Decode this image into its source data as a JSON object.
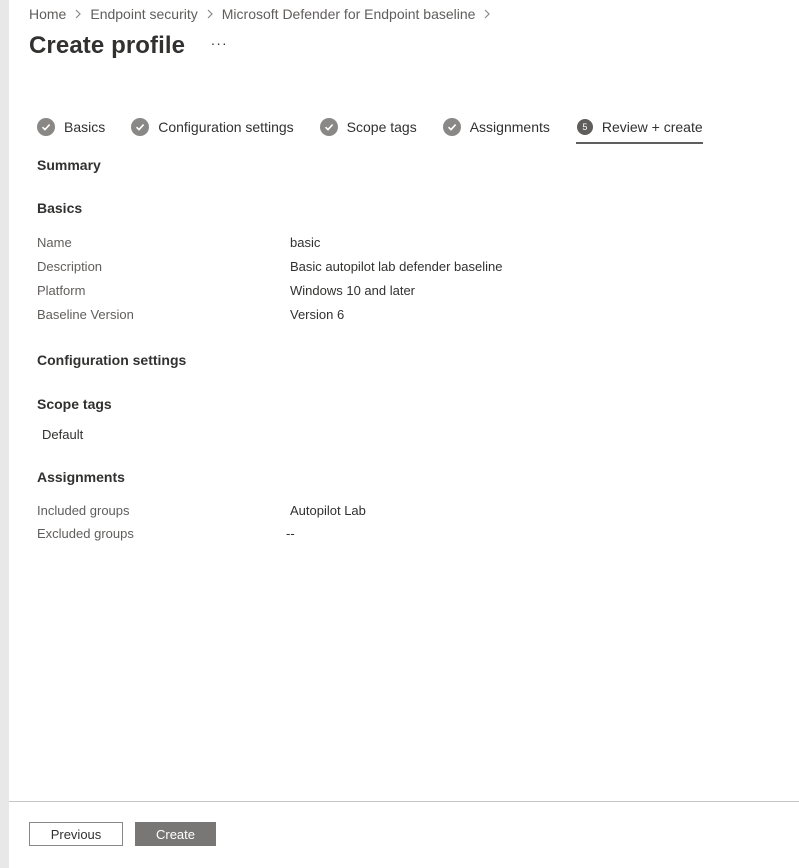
{
  "breadcrumb": {
    "items": [
      "Home",
      "Endpoint security",
      "Microsoft Defender for Endpoint baseline"
    ]
  },
  "page": {
    "title": "Create profile",
    "more_label": "···"
  },
  "steps": [
    {
      "label": "Basics",
      "state": "complete",
      "icon": "checkmark-icon"
    },
    {
      "label": "Configuration settings",
      "state": "complete",
      "icon": "checkmark-icon"
    },
    {
      "label": "Scope tags",
      "state": "complete",
      "icon": "checkmark-icon"
    },
    {
      "label": "Assignments",
      "state": "complete",
      "icon": "checkmark-icon"
    },
    {
      "label": "Review + create",
      "state": "active",
      "number": "5"
    }
  ],
  "summary": {
    "heading": "Summary",
    "basics": {
      "heading": "Basics",
      "rows": [
        {
          "key": "Name",
          "value": "basic"
        },
        {
          "key": "Description",
          "value": "Basic autopilot lab defender baseline"
        },
        {
          "key": "Platform",
          "value": "Windows 10 and later"
        },
        {
          "key": "Baseline Version",
          "value": "Version 6"
        }
      ]
    },
    "configuration_settings": {
      "heading": "Configuration settings"
    },
    "scope_tags": {
      "heading": "Scope tags",
      "items": [
        "Default"
      ]
    },
    "assignments": {
      "heading": "Assignments",
      "rows": [
        {
          "key": "Included groups",
          "value": "Autopilot Lab"
        },
        {
          "key": "Excluded groups",
          "value": "--"
        }
      ]
    }
  },
  "footer": {
    "previous_label": "Previous",
    "create_label": "Create"
  },
  "colors": {
    "step_complete": "#8a8886",
    "step_active": "#605e5c",
    "create_button": "#797775",
    "text_primary": "#323130",
    "text_secondary": "#605e5c"
  }
}
